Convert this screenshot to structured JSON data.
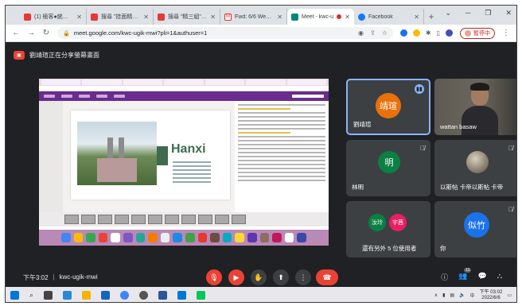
{
  "browser": {
    "tabs": [
      {
        "title": "(1) 極客●統統影",
        "favicon_color": "#e53935",
        "active": false
      },
      {
        "title": "搜尋 \"挂面精髓部\"",
        "favicon_color": "#e53935",
        "active": false
      },
      {
        "title": "搜尋 \"精三組\" - Pl",
        "favicon_color": "#e53935",
        "active": false
      },
      {
        "title": "Fwd: 6/6 Week 1!",
        "favicon_color": "#d93025",
        "active": false
      },
      {
        "title": "Meet - kwc-u",
        "favicon_color": "#00897b",
        "active": true
      },
      {
        "title": "Facebook",
        "favicon_color": "#1877f2",
        "active": false
      }
    ],
    "new_tab_icon": "plus-icon",
    "url": "meet.google.com/kwc-ugik-mwi?pli=1&authuser=1",
    "paused_label": "暫停中"
  },
  "meet": {
    "presenting_banner": "劉靖瑄正在分享螢幕畫面",
    "slide": {
      "title": "Hanxi"
    },
    "participants": [
      {
        "initials": "靖瑄",
        "name": "劉靖瑄",
        "color": "#e8710a",
        "speaking": true
      },
      {
        "name": "wattan basaw",
        "video": true
      },
      {
        "initials": "明",
        "name": "林明",
        "color": "#0b8043",
        "muted": true
      },
      {
        "name": "以斯帖 卡帝以斯帖 卡帝",
        "photo": true,
        "muted": true
      },
      {
        "initials_a": "汝玲",
        "initials_b": "宇茜",
        "name": "還有另外 5 位使用者",
        "color_a": "#0b8043",
        "color_b": "#e91e63"
      },
      {
        "initials": "似竹",
        "name": "你",
        "color": "#1a73e8",
        "muted": true
      }
    ],
    "controls": {
      "time": "下午3:02",
      "separator": "|",
      "meeting_code": "kwc-ugik-mwi",
      "people_count": "11"
    }
  },
  "taskbar": {
    "time": "下午 03:02",
    "date": "2022/6/6",
    "lang": "中"
  }
}
